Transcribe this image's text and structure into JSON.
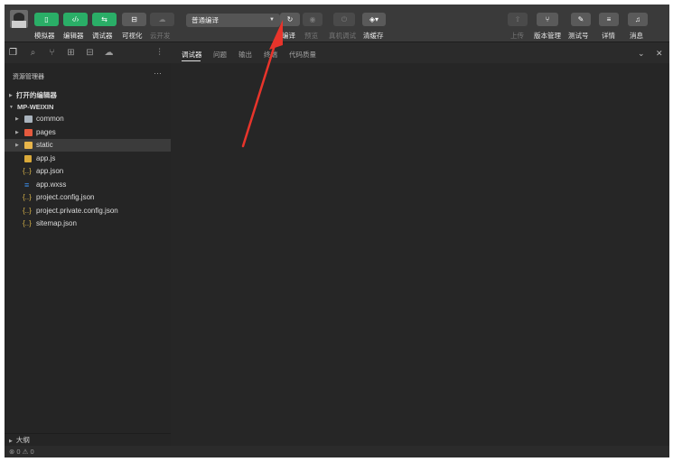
{
  "toolbar": {
    "simulator": {
      "label": "模拟器",
      "icon": "phone-icon"
    },
    "editor": {
      "label": "编辑器",
      "icon": "code-icon"
    },
    "debugger": {
      "label": "调试器",
      "icon": "debug-icon"
    },
    "visual": {
      "label": "可视化",
      "icon": "layout-icon"
    },
    "cloud": {
      "label": "云开发",
      "icon": "cloud-icon"
    },
    "compile_mode": {
      "value": "普通编译"
    },
    "compile": {
      "label": "编译"
    },
    "preview": {
      "label": "预览"
    },
    "real_debug": {
      "label": "真机调试"
    },
    "clear_cache": {
      "label": "清缓存"
    },
    "upload": {
      "label": "上传"
    },
    "version": {
      "label": "版本管理"
    },
    "test_account": {
      "label": "测试号"
    },
    "details": {
      "label": "详情"
    },
    "messages": {
      "label": "消息"
    }
  },
  "explorer": {
    "title": "资源管理器",
    "more": "···",
    "open_editors": "打开的编辑器",
    "project": "MP-WEIXIN",
    "items": [
      {
        "name": "common",
        "type": "folder",
        "icon": "folder-icon"
      },
      {
        "name": "pages",
        "type": "folder",
        "icon": "folder-pages-icon"
      },
      {
        "name": "static",
        "type": "folder",
        "icon": "folder-static-icon"
      },
      {
        "name": "app.js",
        "type": "js",
        "icon": "js-file-icon"
      },
      {
        "name": "app.json",
        "type": "json",
        "icon": "json-file-icon"
      },
      {
        "name": "app.wxss",
        "type": "wxss",
        "icon": "wxss-file-icon"
      },
      {
        "name": "project.config.json",
        "type": "json",
        "icon": "json-file-icon"
      },
      {
        "name": "project.private.config.json",
        "type": "json",
        "icon": "json-file-icon"
      },
      {
        "name": "sitemap.json",
        "type": "json",
        "icon": "json-file-icon"
      }
    ],
    "outline": "大纲"
  },
  "panel": {
    "tabs": [
      "调试器",
      "问题",
      "输出",
      "终端",
      "代码质量"
    ],
    "active": "调试器",
    "minimize": "⌄",
    "close": "✕"
  },
  "status": {
    "errors": "0",
    "warnings": "0"
  },
  "colors": {
    "accent_green": "#2aae67",
    "annotation_red": "#e8342b"
  }
}
